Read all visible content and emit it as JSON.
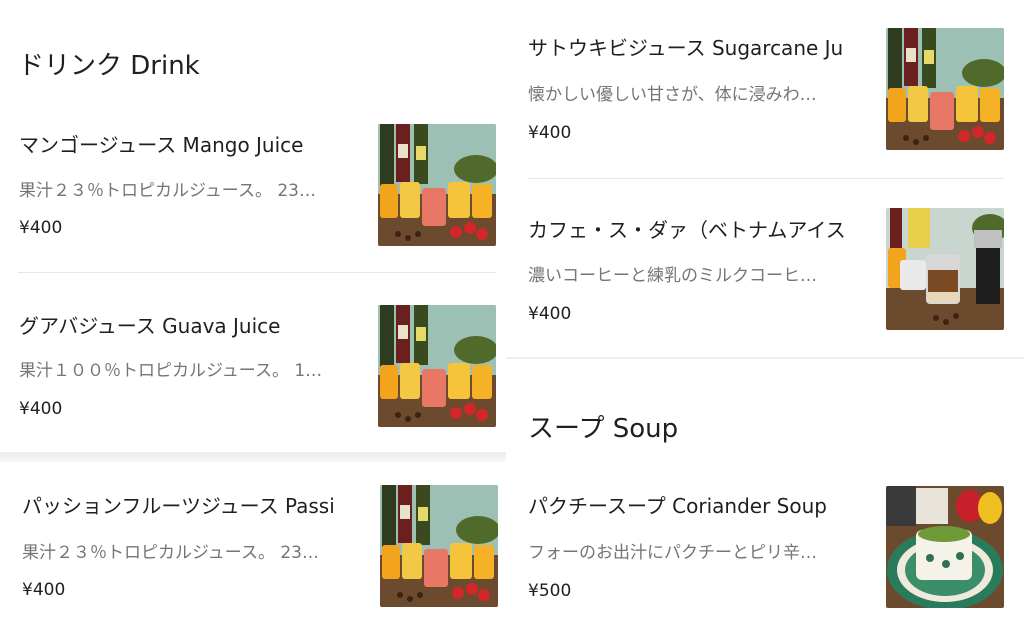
{
  "drink": {
    "title": "ドリンク Drink",
    "items": [
      {
        "name": "マンゴージュース Mango Juice",
        "desc": "果汁２３％トロピカルジュース。 23…",
        "price": "¥400",
        "image": "juice-photo"
      },
      {
        "name": "グアバジュース Guava Juice",
        "desc": "果汁１００％トロピカルジュース。 1…",
        "price": "¥400",
        "image": "juice-photo"
      },
      {
        "name": "パッションフルーツジュース Passi",
        "desc": "果汁２３％トロピカルジュース。 23…",
        "price": "¥400",
        "image": "juice-photo"
      },
      {
        "name": "サトウキビジュース Sugarcane Ju",
        "desc": "懐かしい優しい甘さが、体に浸みわ…",
        "price": "¥400",
        "image": "juice-photo"
      },
      {
        "name": "カフェ・ス・ダァ（ベトナムアイス",
        "desc": "濃いコーヒーと練乳のミルクコーヒ…",
        "price": "¥400",
        "image": "coffee-photo"
      }
    ]
  },
  "soup": {
    "title": "スープ Soup",
    "items": [
      {
        "name": "パクチースープ Coriander Soup",
        "desc": "フォーのお出汁にパクチーとピリ辛…",
        "price": "¥500",
        "image": "soup-photo"
      }
    ]
  }
}
